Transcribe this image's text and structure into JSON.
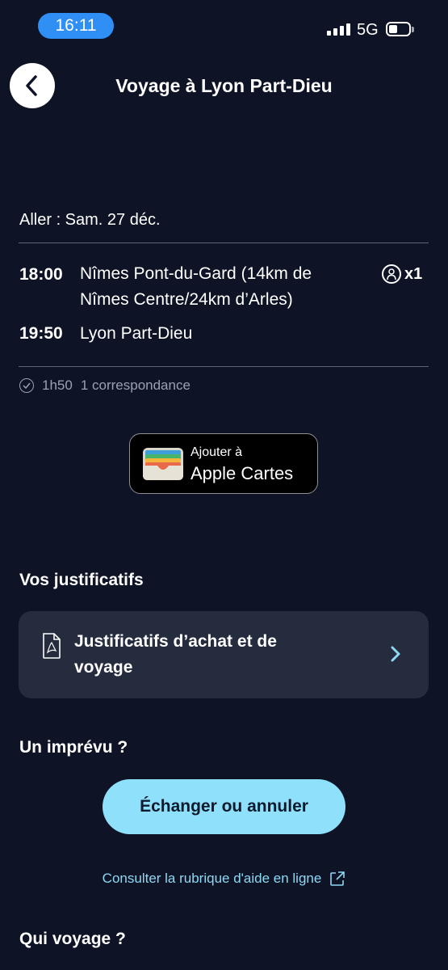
{
  "status_bar": {
    "time": "16:11",
    "network": "5G"
  },
  "header": {
    "title": "Voyage à Lyon Part-Dieu"
  },
  "trip": {
    "date_label": "Aller : Sam. 27 déc.",
    "departure": {
      "time": "18:00",
      "station_line1": "Nîmes Pont-du-Gard (14km de",
      "station_line2": "Nîmes Centre/24km d’Arles)"
    },
    "arrival": {
      "time": "19:50",
      "station": "Lyon Part-Dieu"
    },
    "passengers": "x1",
    "duration": "1h50",
    "connections": "1 correspondance"
  },
  "wallet_button": {
    "line1": "Ajouter à",
    "line2": "Apple Cartes"
  },
  "receipts": {
    "section_title": "Vos justificatifs",
    "card_line1": "Justificatifs d’achat et de",
    "card_line2": "voyage"
  },
  "incident": {
    "section_title": "Un imprévu ?",
    "button_label": "Échanger ou annuler",
    "help_link": "Consulter la rubrique d'aide en ligne"
  },
  "travelers": {
    "section_title": "Qui voyage ?"
  },
  "colors": {
    "background": "#0e1426",
    "accent": "#8fe1fb",
    "card": "#252c3e",
    "link": "#8fd8f3"
  }
}
